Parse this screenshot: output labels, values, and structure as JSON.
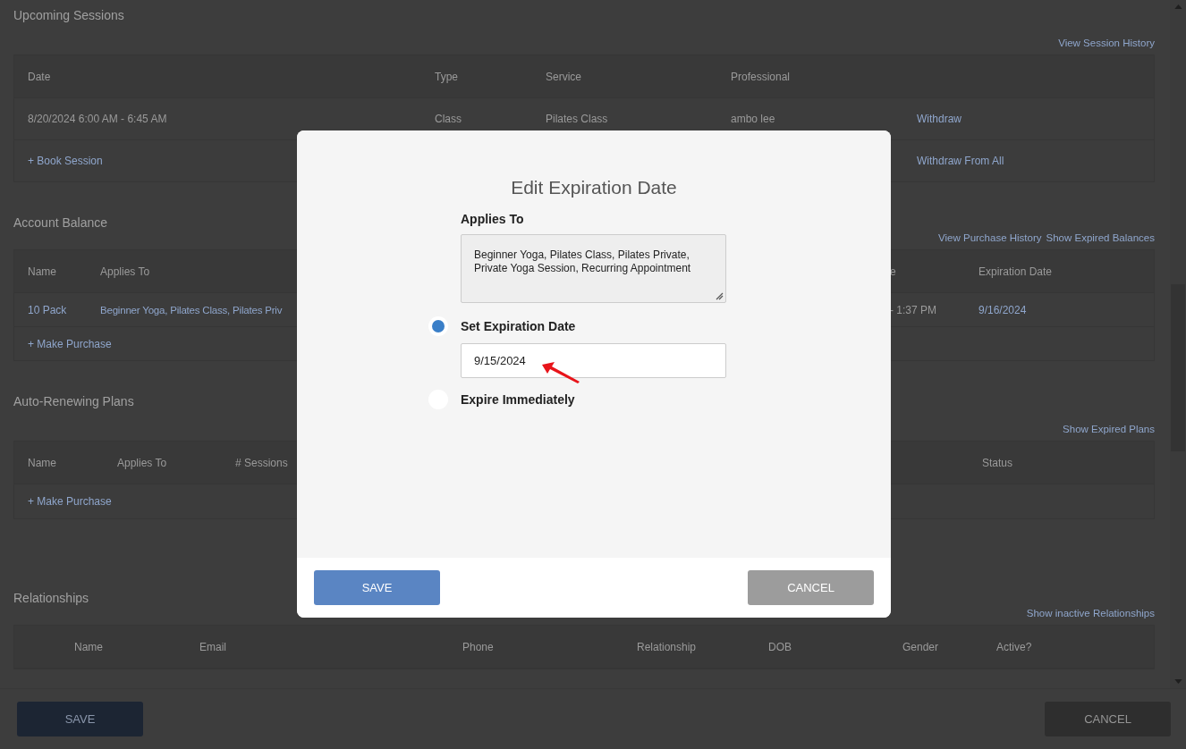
{
  "sections": [
    {
      "kind": "sessions",
      "title": "Upcoming Sessions",
      "links": [
        "View Session History"
      ],
      "columns": [
        "Date",
        "Type",
        "Service",
        "Professional"
      ],
      "rows": [
        {
          "kind": "data",
          "cells": [
            {
              "text": "8/20/2024 6:00 AM - 6:45 AM",
              "link": false
            },
            {
              "text": "Class",
              "link": false
            },
            {
              "text": "Pilates Class",
              "link": false
            },
            {
              "text": "ambo lee",
              "link": false
            },
            {
              "text": "Withdraw",
              "link": true
            }
          ]
        },
        {
          "kind": "actions",
          "links": [
            "+ Book Session",
            "Withdraw From All"
          ]
        }
      ]
    },
    {
      "kind": "balances",
      "title": "Account Balance",
      "links": [
        "View Purchase History",
        "Show Expired Balances"
      ],
      "columns": [
        "Name",
        "Applies To",
        "e",
        "Expiration Date"
      ],
      "rows": [
        {
          "kind": "data",
          "cells": [
            {
              "text": "10 Pack",
              "link": true
            },
            {
              "text": "Beginner Yoga, Pilates Class, Pilates Priv",
              "link": true
            },
            {
              "text": "- 1:37 PM",
              "link": false
            },
            {
              "text": "9/16/2024",
              "link": true
            }
          ]
        },
        {
          "kind": "actions",
          "links": [
            "+ Make Purchase"
          ]
        }
      ]
    },
    {
      "kind": "plans",
      "title": "Auto-Renewing Plans",
      "links": [
        "Show Expired Plans"
      ],
      "columns": [
        "Name",
        "Applies To",
        "# Sessions",
        "Status"
      ],
      "rows": [
        {
          "kind": "actions",
          "links": [
            "+ Make Purchase"
          ]
        }
      ]
    },
    {
      "kind": "people",
      "title": "Relationships",
      "links": [
        "Show inactive Relationships"
      ],
      "columns": [
        "Name",
        "Email",
        "Phone",
        "Relationship",
        "DOB",
        "Gender",
        "Active?"
      ]
    }
  ],
  "footer": {
    "save": "SAVE",
    "cancel": "CANCEL"
  },
  "modal": {
    "title": "Edit Expiration Date",
    "applies_label": "Applies To",
    "applies_value": "Beginner Yoga, Pilates Class, Pilates Private, Private Yoga Session, Recurring Appointment",
    "options": [
      {
        "label": "Set Expiration Date",
        "selected": true
      },
      {
        "label": "Expire Immediately",
        "selected": false
      }
    ],
    "date_value": "9/15/2024",
    "save": "SAVE",
    "cancel": "CANCEL"
  }
}
